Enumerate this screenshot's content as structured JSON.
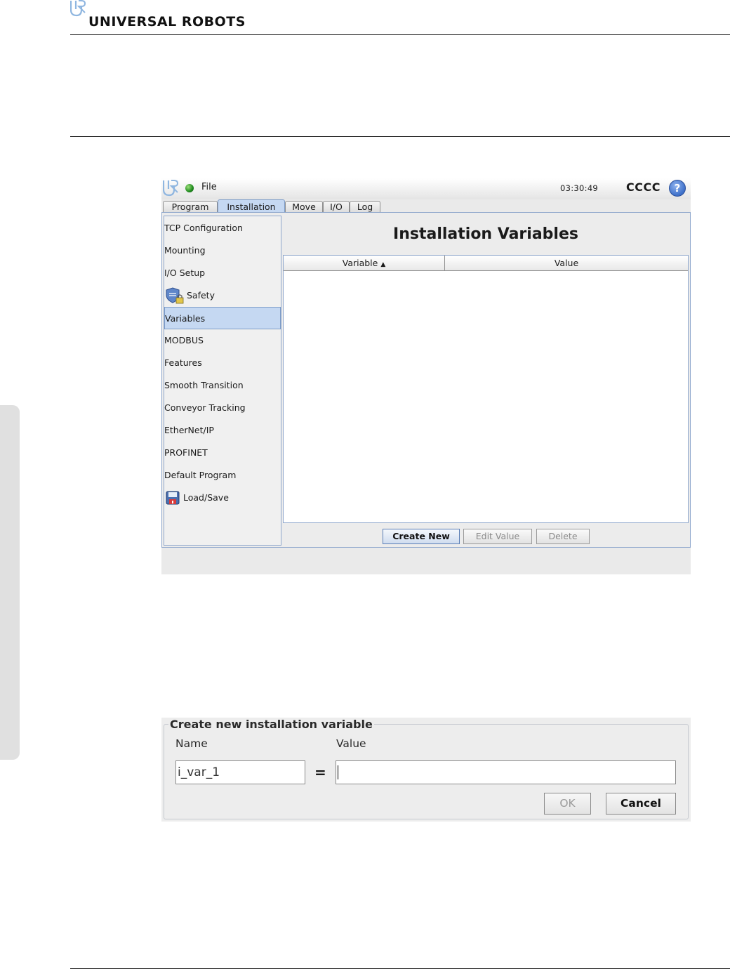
{
  "document": {
    "brand": "UNIVERSAL ROBOTS"
  },
  "polyscope": {
    "menu_file": "File",
    "clock": "03:30:49",
    "robot_name": "CCCC",
    "help_symbol": "?",
    "tabs": [
      {
        "label": "Program"
      },
      {
        "label": "Installation",
        "active": true
      },
      {
        "label": "Move"
      },
      {
        "label": "I/O"
      },
      {
        "label": "Log"
      }
    ],
    "nav": [
      {
        "label": "TCP Configuration"
      },
      {
        "label": "Mounting"
      },
      {
        "label": "I/O Setup"
      },
      {
        "label": "Safety",
        "icon": "safety-shield-lock-icon"
      },
      {
        "label": "Variables",
        "selected": true
      },
      {
        "label": "MODBUS"
      },
      {
        "label": "Features"
      },
      {
        "label": "Smooth Transition"
      },
      {
        "label": "Conveyor Tracking"
      },
      {
        "label": "EtherNet/IP"
      },
      {
        "label": "PROFINET"
      },
      {
        "label": "Default Program"
      },
      {
        "label": "Load/Save",
        "icon": "floppy-disk-icon"
      }
    ],
    "title": "Installation Variables",
    "table": {
      "columns": [
        "Variable",
        "Value"
      ],
      "sort_indicator": "▲",
      "rows": []
    },
    "buttons": {
      "create_new": "Create New",
      "edit_value": "Edit Value",
      "delete": "Delete"
    },
    "colors": {
      "selection": "#c5d8f2",
      "status_led": "#1e8a1e",
      "help": "#3d6fc9"
    }
  },
  "dialog": {
    "legend": "Create new installation variable",
    "name_label": "Name",
    "value_label": "Value",
    "name_value": "i_var_1",
    "value_value": "",
    "equals": "=",
    "ok": "OK",
    "cancel": "Cancel"
  }
}
